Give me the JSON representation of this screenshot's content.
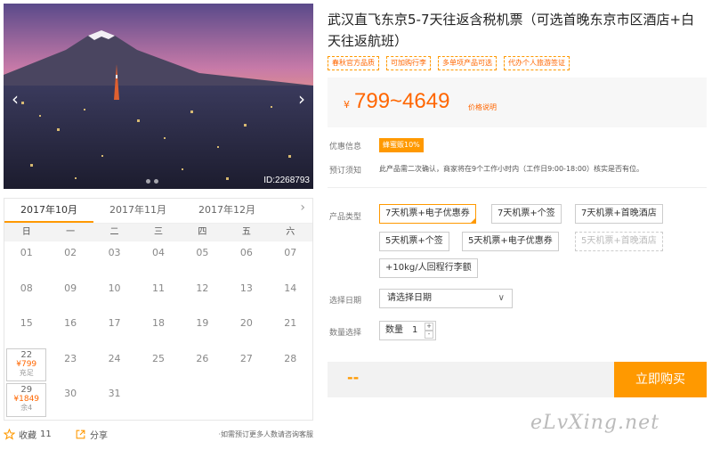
{
  "hero": {
    "image_id": "ID:2268793",
    "prev_arrow": "‹",
    "next_arrow": "›"
  },
  "calendar": {
    "months": [
      "2017年10月",
      "2017年11月",
      "2017年12月"
    ],
    "active_month_index": 0,
    "next_icon": "›",
    "weekdays": [
      "日",
      "一",
      "二",
      "三",
      "四",
      "五",
      "六"
    ],
    "rows": [
      [
        "01",
        "02",
        "03",
        "04",
        "05",
        "06",
        "07"
      ],
      [
        "08",
        "09",
        "10",
        "11",
        "12",
        "13",
        "14"
      ],
      [
        "15",
        "16",
        "17",
        "18",
        "19",
        "20",
        "21"
      ],
      [
        "22",
        "23",
        "24",
        "25",
        "26",
        "27",
        "28"
      ],
      [
        "29",
        "30",
        "31",
        "",
        "",
        "",
        ""
      ]
    ],
    "available": {
      "22": {
        "price": "¥799",
        "stock": "充足"
      },
      "29": {
        "price": "¥1849",
        "stock": "余4"
      }
    }
  },
  "bottom": {
    "favorite_label": "收藏",
    "favorite_count": "11",
    "share_label": "分享",
    "consult_text": "·如需预订更多人数请咨询客服"
  },
  "product": {
    "title": "武汉直飞东京5-7天往返含税机票（可选首晚东京市区酒店+白天往返航班）",
    "tags": [
      "春秋官方品质",
      "可加购行李",
      "多单项产品可选",
      "代办个人旅游签证"
    ],
    "price_currency": "¥",
    "price_range": "799~4649",
    "price_note": "价格说明"
  },
  "info": {
    "discount_label": "优惠信息",
    "discount_badge": "蜂蜜贩10%",
    "notice_label": "预订须知",
    "notice_text": "此产品需二次确认，商家将在9个工作小时内（工作日9:00-18:00）核实是否有位。"
  },
  "options": {
    "label": "产品类型",
    "items": [
      {
        "text": "7天机票+电子优惠券",
        "state": "selected"
      },
      {
        "text": "7天机票+个签",
        "state": "normal"
      },
      {
        "text": "7天机票+首晚酒店",
        "state": "normal"
      },
      {
        "text": "5天机票+个签",
        "state": "normal"
      },
      {
        "text": "5天机票+电子优惠券",
        "state": "normal"
      },
      {
        "text": "5天机票+首晚酒店",
        "state": "disabled"
      },
      {
        "text": "+10kg/人回程行李额",
        "state": "normal"
      }
    ]
  },
  "date": {
    "label": "选择日期",
    "placeholder": "请选择日期",
    "chevron": "∨"
  },
  "quantity": {
    "label": "数量选择",
    "field_label": "数量",
    "value": "1",
    "plus": "+",
    "minus": "-"
  },
  "buy": {
    "total": "--",
    "button": "立即购买"
  },
  "watermark": "eLvXing.net",
  "colors": {
    "accent": "#ff9900",
    "price": "#ff6600"
  }
}
